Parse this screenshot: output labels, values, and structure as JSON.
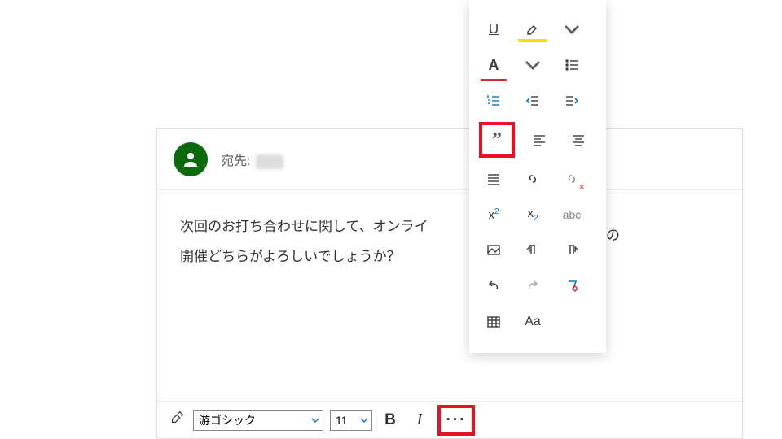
{
  "header": {
    "recipient_label": "宛先:"
  },
  "body": {
    "line1": "次回のお打ち合わせに関して、オンライ",
    "line2": "開催どちらがよろしいでしょうか？"
  },
  "body_trailing": "の",
  "toolbar": {
    "font_name": "游ゴシック",
    "font_size": "11",
    "bold": "B",
    "italic": "I",
    "more": "···"
  },
  "popup": {
    "underline": "U",
    "highlighter": "highlighter-icon",
    "fontcolor": "A",
    "bullets": "bulleted-list-icon",
    "numbered": "numbered-list-icon",
    "outdent": "decrease-indent-icon",
    "indent": "increase-indent-icon",
    "quote": "”",
    "align_left": "align-left-icon",
    "align_center": "align-center-icon",
    "align_justify": "align-justify-icon",
    "link": "link-icon",
    "unlink": "remove-link-icon",
    "superscript_base": "x",
    "superscript_exp": "2",
    "subscript_base": "x",
    "subscript_exp": "2",
    "strike": "abc",
    "insert_image": "insert-image-icon",
    "ltr": "ltr-icon",
    "rtl": "rtl-icon",
    "undo": "undo-icon",
    "redo": "redo-icon",
    "clear_format": "clear-format-icon",
    "table": "insert-table-icon",
    "change_case": "Aa"
  }
}
